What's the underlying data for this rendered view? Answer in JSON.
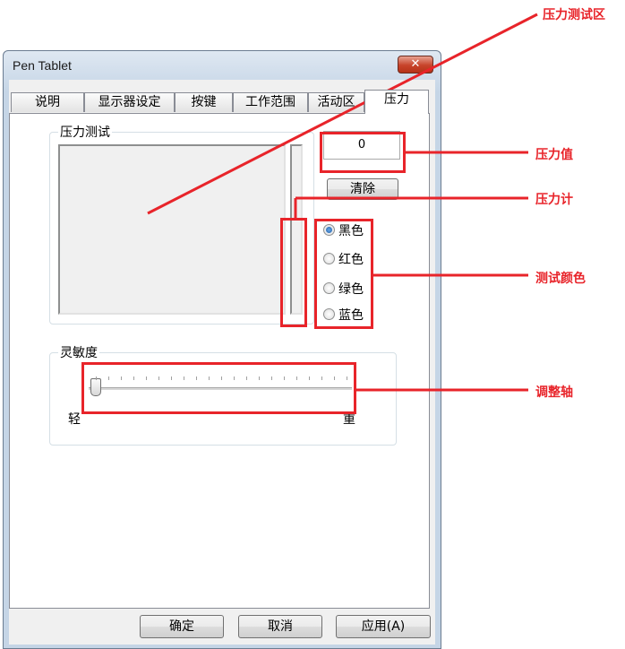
{
  "window": {
    "title": "Pen Tablet",
    "close_symbol": "✕",
    "tabs": [
      "说明",
      "显示器设定",
      "按键",
      "工作范围",
      "活动区",
      "压力"
    ],
    "active_tab": "压力"
  },
  "pressure_test": {
    "group_label": "压力测试",
    "value": "0",
    "clear_label": "清除"
  },
  "colors": {
    "options": [
      "黑色",
      "红色",
      "绿色",
      "蓝色"
    ],
    "selected": "黑色"
  },
  "sensitivity": {
    "group_label": "灵敏度",
    "min_label": "轻",
    "max_label": "重",
    "level": 0
  },
  "footer": {
    "ok_label": "确定",
    "cancel_label": "取消",
    "apply_label": "应用(A)"
  },
  "annotations": {
    "test_area": "压力测试区",
    "value": "压力值",
    "meter": "压力计",
    "color": "测试颜色",
    "slider": "调整轴"
  },
  "accent_color": "#e8242a"
}
